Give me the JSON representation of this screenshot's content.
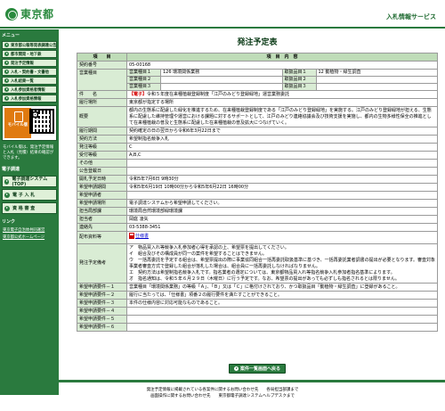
{
  "header": {
    "logo_text": "東京都",
    "service_title": "入札情報サービス"
  },
  "sidebar": {
    "menu_heading": "メニュー",
    "items": [
      {
        "label": "東京都公報等発表調達公告"
      },
      {
        "label": "都市開発・地下鉄"
      },
      {
        "label": "発注予定情報"
      },
      {
        "label": "入札・契約書・文書他"
      },
      {
        "label": "入札結果一覧"
      },
      {
        "label": "入札参加資格者情報"
      },
      {
        "label": "入札参加資格情報"
      }
    ],
    "mobile_label": "モバイル版",
    "mobile_note": "モバイル版は、発注予定情報と入札（見積）結果の確認ができます。",
    "link_heading": "電子調達",
    "big_buttons": [
      {
        "label": "電子調達システム(TOP)"
      },
      {
        "label": "電 子 入 札"
      },
      {
        "label": "資 格 審 査"
      }
    ],
    "links_heading": "リンク",
    "links": [
      {
        "label": "東京電子自治体共同運営"
      },
      {
        "label": "東京都公式ホームページ"
      }
    ]
  },
  "main": {
    "page_title": "発注予定表",
    "table_header": {
      "item": "項　　目",
      "content": "項　目　内　容"
    },
    "contract_no_label": "契約番号",
    "contract_no": "05-00168",
    "type_label": "営業種目",
    "type1_k": "営業種目１",
    "type1_v": "126 環境関係業務",
    "type2_k": "営業種目２",
    "type2_v": "",
    "type3_k": "営業種目３",
    "type3_v": "",
    "cat1_k": "取扱品目１",
    "cat1_v": "12 動植物・緑生調査",
    "cat2_k": "取扱品目２",
    "cat2_v": "",
    "cat3_k": "取扱品目３",
    "cat3_v": "",
    "subject_label": "件　　名",
    "subject_tag": "【電子】",
    "subject_text": "令和５年度在来種植栽登録制度「江戸のみどり登録緑地」運営業務委託",
    "place_label": "履行場所",
    "place": "東京都が指定する場所",
    "summary_label": "概要",
    "summary": "都内の生態系に配慮した緑化を推進するため、在来種植栽登録制度である「江戸のみどり登録緑地」を実施する。江戸のみどり登録緑地が担える、生態系に配慮した維持管理や運営における課題に対するサポートとして、江戸のみどり連絡協議会及び技術支援を実施し、都内の生物多様性保全の推進として在来種植栽の普及と生態系に配慮した在来種植栽の普及拡大につなげていく。",
    "period_label": "履行期間",
    "period": "契約確定の日の翌日から令和6年3月22日まで",
    "method_label": "契約方法",
    "method": "希望制指名競争入札",
    "grade_label": "発注等級",
    "grade": "C",
    "rank_label": "受付等級",
    "rank": "A,B,C",
    "other_label": "その他",
    "other": "",
    "notice_date_label": "公告登載日",
    "notice_date": "",
    "open_date_label": "開札予定日時",
    "open_date": "令和5年7月6日 9時30分",
    "apply_period_label": "希望申請期間",
    "apply_period": "令和5年6月19日 10時00分から令和5年6月22日 16時00分",
    "applicant_label": "希望申請者",
    "applicant": "",
    "apply_place_label": "希望申請場所",
    "apply_place": "電子調達システムから希望申請してください。",
    "dept_label": "担当局部課",
    "dept": "環境局自然環境部緑環境課",
    "person_label": "担当者",
    "person": "岡庭 凌矢",
    "tel_label": "連絡先",
    "tel": "03-5388-3451",
    "doc_label": "配布資料等",
    "doc_file": "仕様書",
    "remarks_label": "発注予定備考",
    "remarks": [
      "ア　物品買入れ等競争入札参加者心得を承認の上、希望票を提出してください。",
      "イ　組合及びその構成員が同一の案件を希望することはできません。",
      "ウ　一括再委託を予定する組合は、希望票提出の際に事業協同組合一括再委託取扱基準に基づき、一括再委託業者調書の提出が必要となります。審査対象事業者審査方式で登録した組合が落札した場合は、組合員に一括再委託しなければなりません。",
      "エ　契約方法は希望制指名競争入札です。指名業者の選定については、東京都物品買入れ等指名競争入札参加者指名基準によります。",
      "オ　指名通知は、令和５年６月２９日（木曜日）に行う予定です。なお、希望票の提出があっても必ずしも指名されるとは限りません。"
    ],
    "req1_label": "希望申請要件－１",
    "req1": "営業種目「環境関係業務」の等級「Ａ」、「Ｂ」又は「Ｃ」に格付けされており、かつ取扱品目「動植物・緑生調査」に登録があること。",
    "req2_label": "希望申請要件－２",
    "req2": "履行に当たっては、「仕様書」項番２の履行要件を満たすことができること。",
    "req3_label": "希望申請要件－３",
    "req3": "本件の仕様内容に対応可能なものであること。",
    "req4_label": "希望申請要件－４",
    "req4": "",
    "req5_label": "希望申請要件－５",
    "req5": "",
    "req6_label": "希望申請要件－６",
    "req6": "",
    "back_button": "案件一覧画面へ戻る"
  },
  "footer": {
    "line1": "発注予定情報に掲載されている各案件に関するお問い合わせ先　　各局担当部課まで",
    "line2": "画面操作に関するお問い合わせ先　　東京都電子調達システムヘルプデスクまで"
  },
  "colors": {
    "brand_green": "#2a7a3e",
    "label_bg": "#d9ecd4",
    "header_bg": "#bfdcb8",
    "electronic_tag": "#d40000"
  }
}
